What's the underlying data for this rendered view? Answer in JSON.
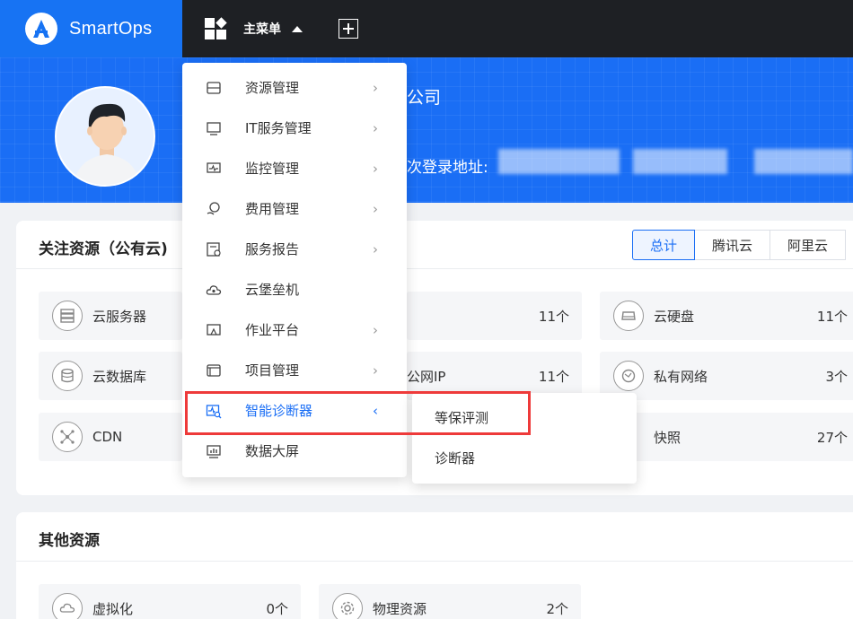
{
  "app": {
    "name": "SmartOps"
  },
  "topnav": {
    "main_menu": "主菜单"
  },
  "banner": {
    "company_suffix": "公司",
    "last_login_label": "次登录地址:"
  },
  "watch_card": {
    "title": "关注资源（公有云)",
    "tabs": [
      "总计",
      "腾讯云",
      "阿里云"
    ],
    "tiles": [
      {
        "name": "云服务器",
        "count": "",
        "icon": "server-icon"
      },
      {
        "name": "",
        "count": "11个",
        "icon": ""
      },
      {
        "name": "云硬盘",
        "count": "11个",
        "icon": "disk-icon"
      },
      {
        "name": "云数据库",
        "count": "",
        "icon": "database-icon"
      },
      {
        "name": "公网IP",
        "count": "11个",
        "icon": ""
      },
      {
        "name": "私有网络",
        "count": "3个",
        "icon": "network-icon"
      },
      {
        "name": "CDN",
        "count": "",
        "icon": "cdn-icon"
      },
      {
        "name": "快照",
        "count": "27个",
        "icon": "snapshot-icon"
      }
    ]
  },
  "other_card": {
    "title": "其他资源",
    "tiles": [
      {
        "name": "虚拟化",
        "count": "0个",
        "icon": "cloud-icon"
      },
      {
        "name": "物理资源",
        "count": "2个",
        "icon": "gear-icon"
      }
    ]
  },
  "menu": {
    "items": [
      {
        "label": "资源管理",
        "icon": "resource-icon",
        "has_children": true
      },
      {
        "label": "IT服务管理",
        "icon": "it-service-icon",
        "has_children": true
      },
      {
        "label": "监控管理",
        "icon": "monitor-icon",
        "has_children": true
      },
      {
        "label": "费用管理",
        "icon": "cost-icon",
        "has_children": true
      },
      {
        "label": "服务报告",
        "icon": "report-icon",
        "has_children": true
      },
      {
        "label": "云堡垒机",
        "icon": "bastion-icon",
        "has_children": false
      },
      {
        "label": "作业平台",
        "icon": "job-icon",
        "has_children": true
      },
      {
        "label": "项目管理",
        "icon": "project-icon",
        "has_children": true
      },
      {
        "label": "智能诊断器",
        "icon": "diagnose-icon",
        "has_children": true,
        "active": true
      },
      {
        "label": "数据大屏",
        "icon": "dashboard-icon",
        "has_children": false
      }
    ],
    "submenu": [
      "等保评测",
      "诊断器"
    ]
  },
  "colors": {
    "brand": "#1773f3",
    "banner": "#1a6ef5",
    "topbar": "#1e2024",
    "highlight": "#ee3a3a"
  }
}
